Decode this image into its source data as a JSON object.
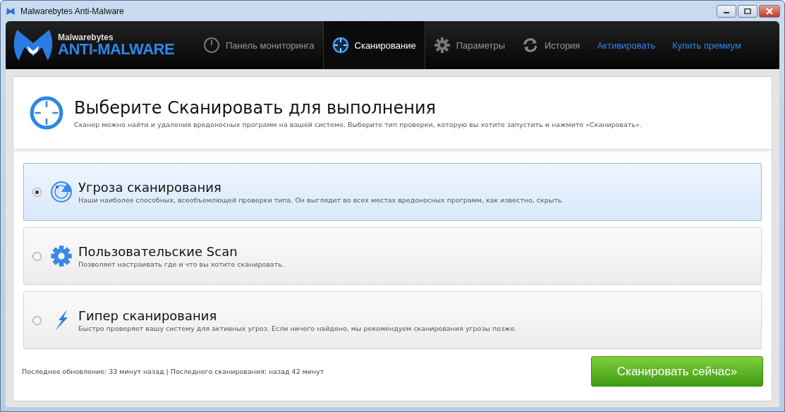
{
  "window": {
    "title": "Malwarebytes Anti-Malware"
  },
  "logo": {
    "brand": "Malwarebytes",
    "product": "ANTI-MALWARE"
  },
  "nav": [
    {
      "label": "Панель мониторинга",
      "kind": "tab",
      "selected": false
    },
    {
      "label": "Сканирование",
      "kind": "tab",
      "selected": true
    },
    {
      "label": "Параметры",
      "kind": "tab",
      "selected": false
    },
    {
      "label": "История",
      "kind": "tab",
      "selected": false
    },
    {
      "label": "Активировать",
      "kind": "link"
    },
    {
      "label": "Купить премиум",
      "kind": "link"
    }
  ],
  "header": {
    "title": "Выберите Сканировать для выполнения",
    "description": "Сканер можно найти и удаления вредоносных программ на вашей системе. Выберите тип проверки, которую вы хотите запустить и нажмите «Сканировать»."
  },
  "scan_options": [
    {
      "title": "Угроза сканирования",
      "description": "Наши наиболее способных, всеобъемлющей проверки типа. Он выглядит во всех местах вредоносных программ, как известно, скрыть.",
      "selected": true
    },
    {
      "title": "Пользовательские Scan",
      "description": "Позволяет настраивать где и что вы хотите сканировать.",
      "selected": false
    },
    {
      "title": "Гипер сканирования",
      "description": "Быстро проверяет вашу систему для активных угроз. Если ничего найдено, мы рекомендуем сканирования угрозы позже.",
      "selected": false
    }
  ],
  "status": "Последнее обновление: 33 минут назад | Последнего сканирования: назад 42 минут",
  "scan_button": "Сканировать сейчас»"
}
